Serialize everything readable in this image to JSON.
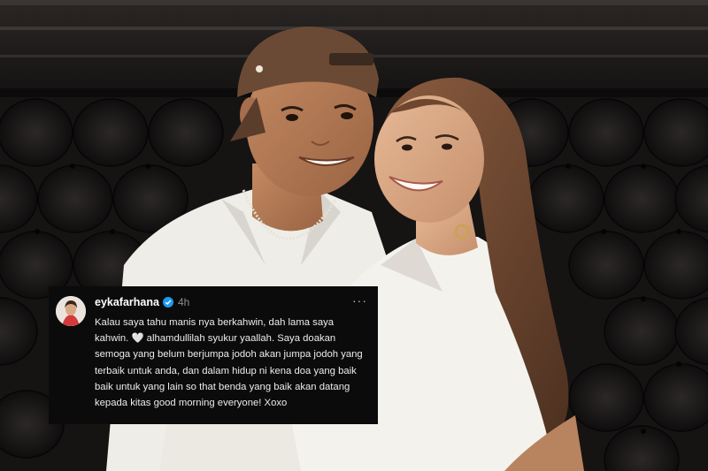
{
  "post": {
    "username": "eykafarhana",
    "timestamp": "4h",
    "more_menu": "···",
    "text_part1": "Kalau saya tahu manis nya berkahwin, dah lama saya kahwin.",
    "heart_emoji": "🤍",
    "text_part2": "alhamdullilah syukur yaallah. Saya doakan semoga yang belum berjumpa jodoh akan jumpa jodoh yang terbaik untuk anda, dan dalam hidup ni kena doa yang baik baik untuk yang lain so that benda yang baik akan datang kepada kitas good morning everyone! Xoxo",
    "verified_icon": "verified-badge-icon"
  },
  "photo": {
    "description_icon": "couple-photo",
    "colors": {
      "sofa": "#1b1818",
      "shirt": "#f3f1ec",
      "cap": "#6b4a35",
      "hair": "#7a5036",
      "skin_man": "#b57a55",
      "skin_woman": "#d9a784"
    }
  }
}
